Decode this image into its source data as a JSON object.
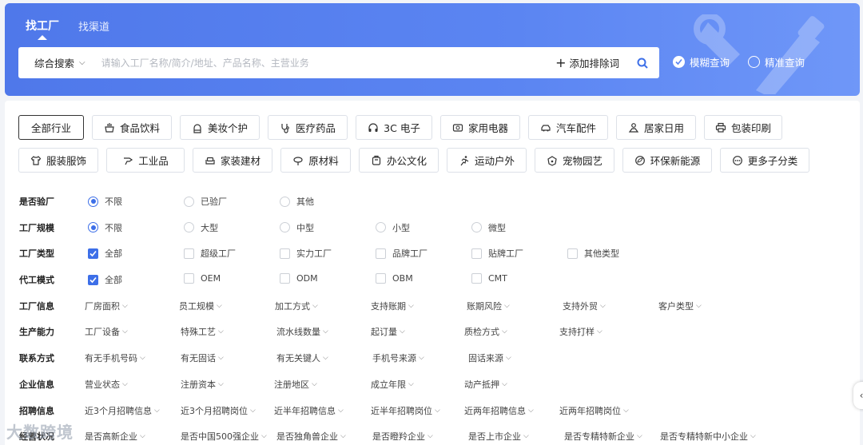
{
  "tabs": [
    "找工厂",
    "找渠道"
  ],
  "search": {
    "type_label": "综合搜索",
    "placeholder": "请输入工厂名称/简介/地址、产品名称、主营业务",
    "add_exclude_label": "添加排除词"
  },
  "modes": {
    "fuzzy": "模糊查询",
    "exact": "精准查询"
  },
  "industries_row1": [
    {
      "label": "全部行业",
      "icon": "none",
      "w": 82,
      "active": true
    },
    {
      "label": "食品饮料",
      "icon": "food-icon",
      "w": 100
    },
    {
      "label": "美妆个护",
      "icon": "beauty-icon",
      "w": 100
    },
    {
      "label": "医疗药品",
      "icon": "medical-icon",
      "w": 100
    },
    {
      "label": "3C 电子",
      "icon": "headphone-icon",
      "w": 96
    },
    {
      "label": "家用电器",
      "icon": "appliance-icon",
      "w": 100
    },
    {
      "label": "汽车配件",
      "icon": "car-icon",
      "w": 100
    },
    {
      "label": "居家日用",
      "icon": "home-icon",
      "w": 100
    },
    {
      "label": "包装印刷",
      "icon": "printer-icon",
      "w": 98
    }
  ],
  "industries_row2": [
    {
      "label": "服装服饰",
      "icon": "shirt-icon",
      "w": 100
    },
    {
      "label": "工业品",
      "icon": "tool-icon",
      "w": 98
    },
    {
      "label": "家装建材",
      "icon": "sofa-icon",
      "w": 100
    },
    {
      "label": "原材料",
      "icon": "material-icon",
      "w": 88
    },
    {
      "label": "办公文化",
      "icon": "office-icon",
      "w": 100
    },
    {
      "label": "运动户外",
      "icon": "sport-icon",
      "w": 100
    },
    {
      "label": "宠物园艺",
      "icon": "pet-icon",
      "w": 100
    },
    {
      "label": "环保新能源",
      "icon": "eco-icon",
      "w": 112
    },
    {
      "label": "更多子分类",
      "icon": "more-icon",
      "w": 112
    }
  ],
  "filters": [
    {
      "label": "是否验厂",
      "kind": "radio",
      "options": [
        "不限",
        "已验厂",
        "其他"
      ],
      "selected": 0
    },
    {
      "label": "工厂规模",
      "kind": "radio",
      "options": [
        "不限",
        "大型",
        "中型",
        "小型",
        "微型"
      ],
      "selected": 0
    },
    {
      "label": "工厂类型",
      "kind": "check",
      "options": [
        "全部",
        "超级工厂",
        "实力工厂",
        "品牌工厂",
        "贴牌工厂",
        "其他类型"
      ],
      "selected": 0
    },
    {
      "label": "代工模式",
      "kind": "check",
      "options": [
        "全部",
        "OEM",
        "ODM",
        "OBM",
        "CMT"
      ],
      "selected": 0
    },
    {
      "label": "工厂信息",
      "kind": "dd",
      "options": [
        "厂房面积",
        "员工规模",
        "加工方式",
        "支持账期",
        "账期风险",
        "支持外贸",
        "客户类型"
      ]
    },
    {
      "label": "生产能力",
      "kind": "dd",
      "options": [
        "工厂设备",
        "特殊工艺",
        "流水线数量",
        "起订量",
        "质检方式",
        "支持打样"
      ]
    },
    {
      "label": "联系方式",
      "kind": "dd",
      "options": [
        "有无手机号码",
        "有无固话",
        "有无关键人",
        "手机号来源",
        "固话来源"
      ]
    },
    {
      "label": "企业信息",
      "kind": "dd",
      "options": [
        "营业状态",
        "注册资本",
        "注册地区",
        "成立年限",
        "动产抵押"
      ]
    },
    {
      "label": "招聘信息",
      "kind": "dd",
      "options": [
        "近3个月招聘信息",
        "近3个月招聘岗位",
        "近半年招聘信息",
        "近半年招聘岗位",
        "近两年招聘信息",
        "近两年招聘岗位"
      ]
    },
    {
      "label": "经营状况",
      "kind": "dd",
      "options": [
        "是否高新企业",
        "是否中国500强企业",
        "是否独角兽企业",
        "是否瞪羚企业",
        "是否上市企业",
        "是否专精特新企业",
        "是否专精特新中小企业"
      ]
    }
  ],
  "watermark": "大数跨境"
}
